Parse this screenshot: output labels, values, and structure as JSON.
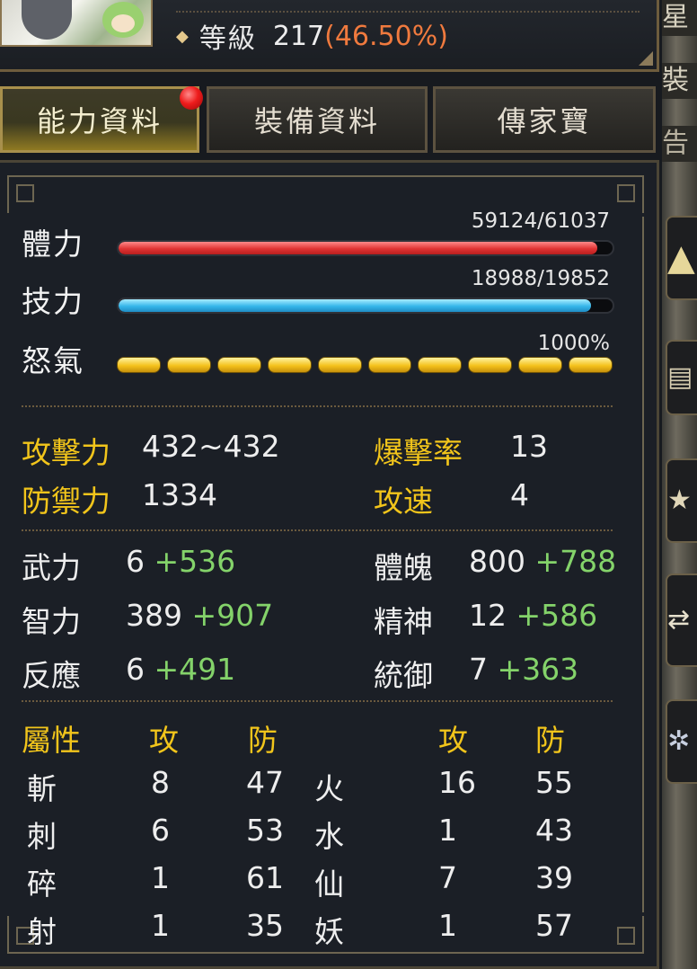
{
  "header": {
    "level_label": "等級",
    "level_value": "217",
    "level_percent": "(46.50%)"
  },
  "tabs": [
    {
      "label": "能力資料",
      "active": true,
      "has_notification": true
    },
    {
      "label": "裝備資料",
      "active": false
    },
    {
      "label": "傳家寶",
      "active": false
    }
  ],
  "bars": {
    "hp": {
      "label": "體力",
      "value": "59124/61037",
      "fraction": 0.9687
    },
    "mp": {
      "label": "技力",
      "value": "18988/19852",
      "fraction": 0.9565
    },
    "rage": {
      "label": "怒氣",
      "value": "1000%",
      "segments": 10,
      "filled": 10
    }
  },
  "combat": {
    "attack": {
      "label": "攻擊力",
      "value": "432~432"
    },
    "defense": {
      "label": "防禦力",
      "value": "1334"
    },
    "crit": {
      "label": "爆擊率",
      "value": "13"
    },
    "speed": {
      "label": "攻速",
      "value": "4"
    }
  },
  "attributes": [
    {
      "label": "武力",
      "base": "6",
      "bonus": "+536"
    },
    {
      "label": "智力",
      "base": "389",
      "bonus": "+907"
    },
    {
      "label": "反應",
      "base": "6",
      "bonus": "+491"
    },
    {
      "label": "體魄",
      "base": "800",
      "bonus": "+788"
    },
    {
      "label": "精神",
      "base": "12",
      "bonus": "+586"
    },
    {
      "label": "統御",
      "base": "7",
      "bonus": "+363"
    }
  ],
  "elements": {
    "header_label": "屬性",
    "atk_header": "攻",
    "def_header": "防",
    "left": [
      {
        "name": "斬",
        "atk": "8",
        "def": "47"
      },
      {
        "name": "刺",
        "atk": "6",
        "def": "53"
      },
      {
        "name": "碎",
        "atk": "1",
        "def": "61"
      },
      {
        "name": "射",
        "atk": "1",
        "def": "35"
      }
    ],
    "right": [
      {
        "name": "火",
        "atk": "16",
        "def": "55"
      },
      {
        "name": "水",
        "atk": "1",
        "def": "43"
      },
      {
        "name": "仙",
        "atk": "7",
        "def": "39"
      },
      {
        "name": "妖",
        "atk": "1",
        "def": "57"
      }
    ]
  },
  "side_panel": {
    "fragments": [
      "星",
      "裝",
      "告"
    ]
  },
  "colors": {
    "gold_label": "#f2c51b",
    "bonus_green": "#84d36a",
    "level_percent": "#f07a3e",
    "hp_bar": "#e03434",
    "mp_bar": "#36b6ea",
    "rage_bar": "#f4c21c"
  }
}
